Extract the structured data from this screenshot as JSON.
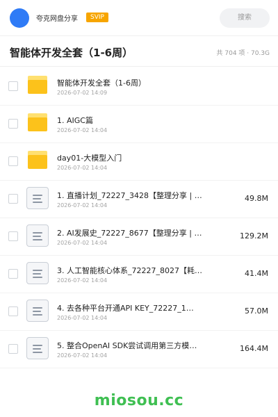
{
  "header": {
    "owner_name": "夸克网盘分享",
    "vip_label": "SVIP",
    "search_label": "搜索"
  },
  "folder": {
    "title": "智能体开发全套（1-6周）",
    "summary": "共 704 项 · 70.3G"
  },
  "files": [
    {
      "type": "folder",
      "name": "智能体开发全套（1-6周）",
      "date": "2026-07-02 14:09",
      "size": ""
    },
    {
      "type": "folder",
      "name": "1. AIGC篇",
      "date": "2026-07-02 14:04",
      "size": ""
    },
    {
      "type": "folder",
      "name": "day01-大模型入门",
      "date": "2026-07-02 14:04",
      "size": ""
    },
    {
      "type": "file",
      "name": "1. 直播计划_72227_3428【整理分享 | 关…",
      "date": "2026-07-02 14:04",
      "size": "49.8M"
    },
    {
      "type": "file",
      "name": "2. AI发展史_72227_8677【整理分享 | …",
      "date": "2026-07-02 14:04",
      "size": "129.2M"
    },
    {
      "type": "file",
      "name": "3. 人工智能核心体系_72227_8027【耗费…",
      "date": "2026-07-02 14:04",
      "size": "41.4M"
    },
    {
      "type": "file",
      "name": "4. 去各种平台开通API KEY_72227_1…",
      "date": "2026-07-02 14:04",
      "size": "57.0M"
    },
    {
      "type": "file",
      "name": "5. 整合OpenAI SDK尝试调用第三方模型_…",
      "date": "2026-07-02 14:04",
      "size": "164.4M"
    }
  ],
  "watermark": "miosou.cc",
  "colors": {
    "avatar": "#2f7bf6",
    "vip_badge": "#f7a500",
    "folder": "#fcc21b",
    "watermark": "#3fbf52"
  },
  "icons": {
    "folder": "folder-icon",
    "file": "document-icon"
  }
}
